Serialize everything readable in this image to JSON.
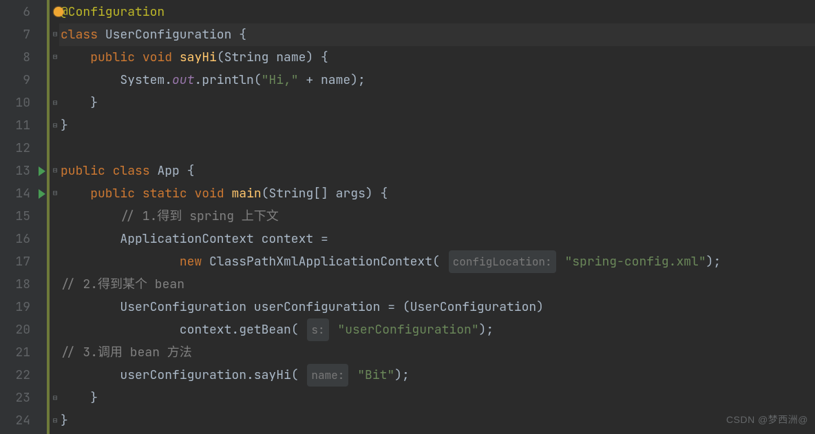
{
  "editor": {
    "first_line_number": 6,
    "highlighted_line": 7,
    "run_icons_on": [
      13,
      14
    ],
    "fold_marks": {
      "6": "bulb",
      "7": "open-down",
      "8": "open-down",
      "10": "close-up",
      "11": "close-up",
      "13": "open-down",
      "14": "open-down",
      "23": "close-up",
      "24": "close-up"
    }
  },
  "tokens": {
    "l6": [
      [
        "ann",
        "@Configuration"
      ]
    ],
    "l7": [
      [
        "kw",
        "class"
      ],
      [
        "pln",
        " "
      ],
      [
        "id",
        "UserConfiguration"
      ],
      [
        "pln",
        " {"
      ]
    ],
    "l8": [
      [
        "pln",
        "    "
      ],
      [
        "kw",
        "public"
      ],
      [
        "pln",
        " "
      ],
      [
        "kw",
        "void"
      ],
      [
        "pln",
        " "
      ],
      [
        "mth",
        "sayHi"
      ],
      [
        "pln",
        "(String name) {"
      ]
    ],
    "l9": [
      [
        "pln",
        "        System."
      ],
      [
        "fld",
        "out"
      ],
      [
        "pln",
        ".println("
      ],
      [
        "str",
        "\"Hi,\""
      ],
      [
        "pln",
        " + name);"
      ]
    ],
    "l10": [
      [
        "pln",
        "    }"
      ]
    ],
    "l11": [
      [
        "pln",
        "}"
      ]
    ],
    "l12": [
      [
        "pln",
        ""
      ]
    ],
    "l13": [
      [
        "kw",
        "public"
      ],
      [
        "pln",
        " "
      ],
      [
        "kw",
        "class"
      ],
      [
        "pln",
        " "
      ],
      [
        "id",
        "App"
      ],
      [
        "pln",
        " {"
      ]
    ],
    "l14": [
      [
        "pln",
        "    "
      ],
      [
        "kw",
        "public"
      ],
      [
        "pln",
        " "
      ],
      [
        "kw",
        "static"
      ],
      [
        "pln",
        " "
      ],
      [
        "kw",
        "void"
      ],
      [
        "pln",
        " "
      ],
      [
        "mth",
        "main"
      ],
      [
        "pln",
        "(String[] args) {"
      ]
    ],
    "l15": [
      [
        "pln",
        "        "
      ],
      [
        "cmt",
        "// 1.得到 spring 上下文"
      ]
    ],
    "l16": [
      [
        "pln",
        "        ApplicationContext context ="
      ]
    ],
    "l17": [
      [
        "pln",
        "                "
      ],
      [
        "kw",
        "new"
      ],
      [
        "pln",
        " ClassPathXmlApplicationContext( "
      ],
      [
        "hint",
        "configLocation:"
      ],
      [
        "pln",
        " "
      ],
      [
        "str",
        "\"spring-config.xml\""
      ],
      [
        "pln",
        ");"
      ]
    ],
    "l18": [
      [
        "cmt",
        "// 2.得到某个 bean"
      ]
    ],
    "l19": [
      [
        "pln",
        "        UserConfiguration userConfiguration = (UserConfiguration)"
      ]
    ],
    "l20": [
      [
        "pln",
        "                context.getBean( "
      ],
      [
        "hint",
        "s:"
      ],
      [
        "pln",
        " "
      ],
      [
        "str",
        "\"userConfiguration\""
      ],
      [
        "pln",
        ");"
      ]
    ],
    "l21": [
      [
        "cmt",
        "// 3.调用 bean 方法"
      ]
    ],
    "l22": [
      [
        "pln",
        "        userConfiguration.sayHi( "
      ],
      [
        "hint",
        "name:"
      ],
      [
        "pln",
        " "
      ],
      [
        "str",
        "\"Bit\""
      ],
      [
        "pln",
        ");"
      ]
    ],
    "l23": [
      [
        "pln",
        "    }"
      ]
    ],
    "l24": [
      [
        "pln",
        "}"
      ]
    ]
  },
  "watermark": "CSDN @梦西洲@"
}
